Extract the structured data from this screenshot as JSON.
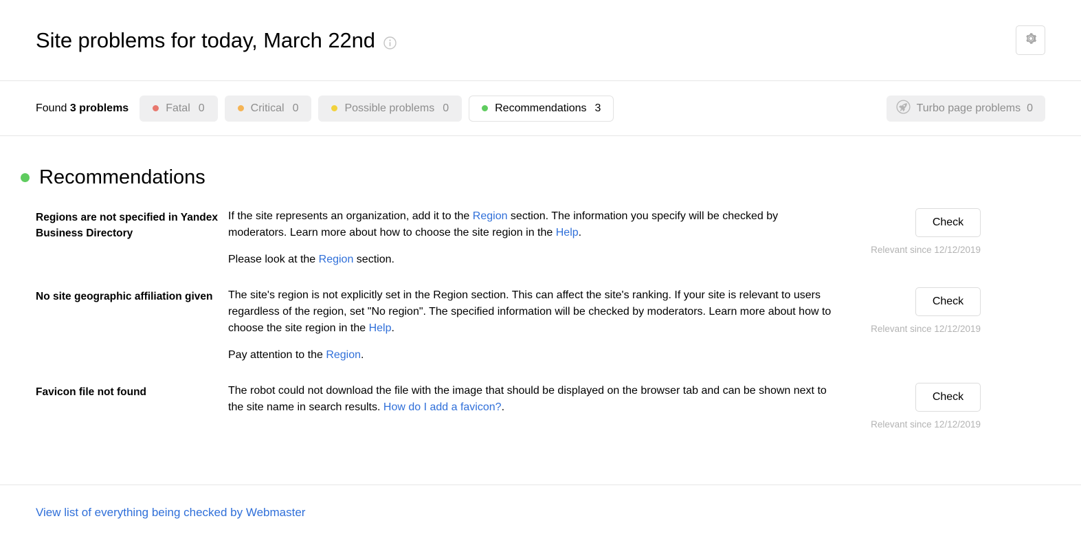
{
  "header": {
    "title": "Site problems for today, March 22nd",
    "info_icon": "info-circle-icon",
    "settings_icon": "gear-icon"
  },
  "filterbar": {
    "found_prefix": "Found",
    "found_strong": "3 problems",
    "tabs": [
      {
        "label": "Fatal",
        "count": "0",
        "color": "#e8786e",
        "selected": false
      },
      {
        "label": "Critical",
        "count": "0",
        "color": "#f5b455",
        "selected": false
      },
      {
        "label": "Possible problems",
        "count": "0",
        "color": "#f2d23c",
        "selected": false
      },
      {
        "label": "Recommendations",
        "count": "3",
        "color": "#5fcc5f",
        "selected": true
      }
    ],
    "turbo": {
      "label": "Turbo page problems",
      "count": "0",
      "icon": "rocket-icon"
    }
  },
  "section": {
    "title": "Recommendations",
    "dot_color": "#5fcc5f"
  },
  "rows": [
    {
      "title": "Regions are not specified in Yandex Business Directory",
      "paragraph1": {
        "part1": "If the site represents an organization, add it to the ",
        "link1": "Region",
        "part2": " section. The information you specify will be checked by moderators. Learn more about how to choose the site region in the ",
        "link2": "Help",
        "part3": "."
      },
      "paragraph2": {
        "part1": "Please look at the ",
        "link1": "Region",
        "part2": " section."
      },
      "button": "Check",
      "relevant": "Relevant since 12/12/2019"
    },
    {
      "title": "No site geographic affiliation given",
      "paragraph1": {
        "part1": "The site's region is not explicitly set in the Region section. This can affect the site's ranking. If your site is relevant to users regardless of the region, set \"No region\". The specified information will be checked by moderators. Learn more about how to choose the site region in the ",
        "link2": "Help",
        "part3": "."
      },
      "paragraph2": {
        "part1": "Pay attention to the ",
        "link1": "Region",
        "part2": "."
      },
      "button": "Check",
      "relevant": "Relevant since 12/12/2019"
    },
    {
      "title": "Favicon file not found",
      "paragraph1": {
        "part1": "The robot could not download the file with the image that should be displayed on the browser tab and can be shown next to the site name in search results. ",
        "link2": "How do I add a favicon?",
        "part3": "."
      },
      "button": "Check",
      "relevant": "Relevant since 12/12/2019"
    }
  ],
  "footer": {
    "link": "View list of everything being checked by Webmaster"
  }
}
